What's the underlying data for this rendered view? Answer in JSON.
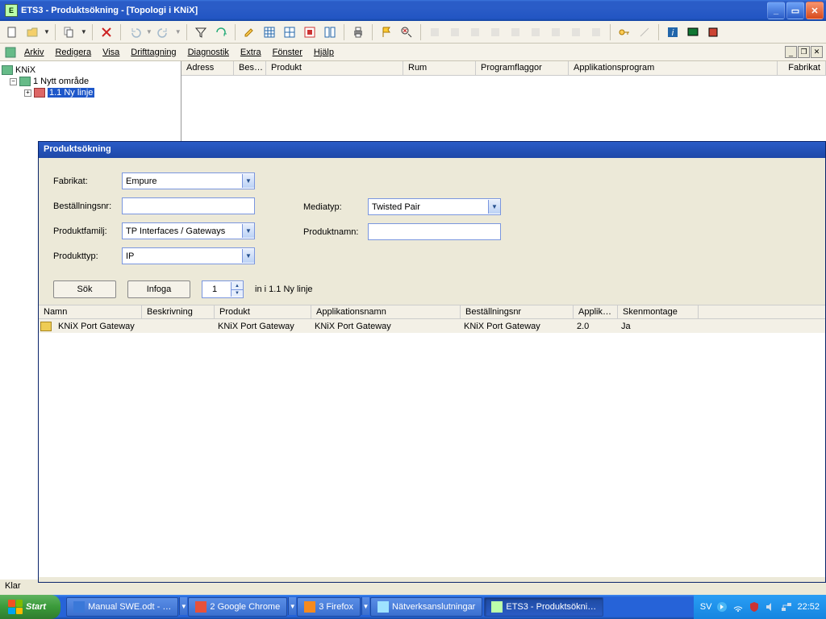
{
  "window": {
    "title": "ETS3 - Produktsökning - [Topologi i KNiX]"
  },
  "menu": {
    "arkiv": "Arkiv",
    "redigera": "Redigera",
    "visa": "Visa",
    "drifttagning": "Drifttagning",
    "diagnostik": "Diagnostik",
    "extra": "Extra",
    "fonster": "Fönster",
    "hjalp": "Hjälp"
  },
  "tree": {
    "root": "KNiX",
    "area": "1 Nytt område",
    "line": "1.1 Ny linje"
  },
  "grid": {
    "adress": "Adress",
    "bes": "Bes…",
    "produkt": "Produkt",
    "rum": "Rum",
    "programflaggor": "Programflaggor",
    "applikationsprogram": "Applikationsprogram",
    "fabrikat": "Fabrikat"
  },
  "dialog": {
    "title": "Produktsökning",
    "labels": {
      "fabrikat": "Fabrikat:",
      "bestallningsnr": "Beställningsnr:",
      "produktfamilj": "Produktfamilj:",
      "produkttyp": "Produkttyp:",
      "mediatyp": "Mediatyp:",
      "produktnamn": "Produktnamn:"
    },
    "values": {
      "fabrikat": "Empure",
      "produktfamilj": "TP Interfaces / Gateways",
      "produkttyp": "IP",
      "mediatyp": "Twisted Pair",
      "bestallningsnr": "",
      "produktnamn": ""
    },
    "buttons": {
      "sok": "Sök",
      "infoga": "Infoga"
    },
    "spinner_value": "1",
    "insert_in": "in i   1.1 Ny linje",
    "rescols": {
      "namn": "Namn",
      "beskrivning": "Beskrivning",
      "produkt": "Produkt",
      "applikationsnamn": "Applikationsnamn",
      "bestallningsnr": "Beställningsnr",
      "applik": "Applik…",
      "skenmontage": "Skenmontage"
    },
    "row": {
      "namn": "KNiX Port Gateway",
      "beskrivning": "",
      "produkt": "KNiX Port Gateway",
      "applikationsnamn": "KNiX Port Gateway",
      "bestallningsnr": "KNiX Port Gateway",
      "applik": "2.0",
      "skenmontage": "Ja"
    }
  },
  "status": "Klar",
  "taskbar": {
    "start": "Start",
    "items": [
      {
        "label": "Manual SWE.odt - …",
        "color": "#3a78d8"
      },
      {
        "label": "2 Google Chrome",
        "color": "#e6513b"
      },
      {
        "label": "3 Firefox",
        "color": "#f58a1f"
      },
      {
        "label": "Nätverksanslutningar",
        "color": "#9fe2ff"
      },
      {
        "label": "ETS3 - Produktsökni…",
        "color": "#bfa"
      }
    ],
    "lang": "SV",
    "clock": "22:52"
  }
}
